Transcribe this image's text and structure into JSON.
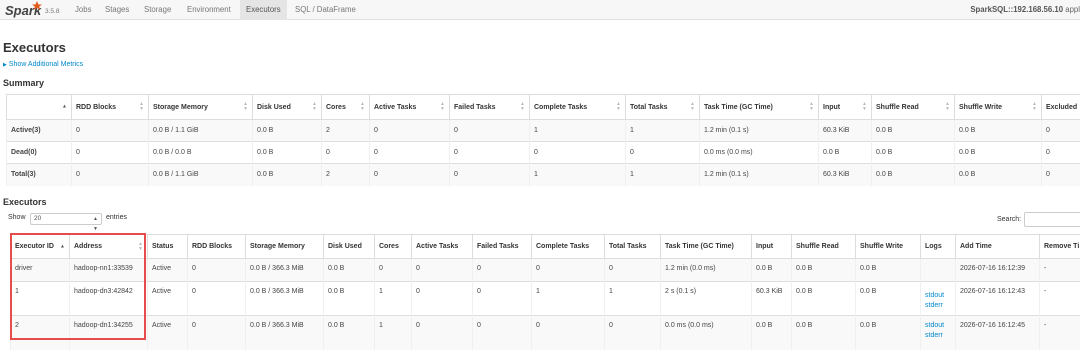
{
  "nav": {
    "logo_text": "Spark",
    "version": "3.5.8",
    "items": [
      "Jobs",
      "Stages",
      "Storage",
      "Environment",
      "Executors",
      "SQL / DataFrame"
    ],
    "active": "Executors",
    "app_title": "SparkSQL::192.168.56.10",
    "app_suffix": " appl"
  },
  "page": {
    "title": "Executors",
    "show_metrics": "Show Additional Metrics",
    "summary_heading": "Summary",
    "executors_heading": "Executors"
  },
  "summary": {
    "headers": [
      "",
      "RDD Blocks",
      "Storage Memory",
      "Disk Used",
      "Cores",
      "Active Tasks",
      "Failed Tasks",
      "Complete Tasks",
      "Total Tasks",
      "Task Time (GC Time)",
      "Input",
      "Shuffle Read",
      "Shuffle Write",
      "Excluded"
    ],
    "rows": [
      [
        "Active(3)",
        "0",
        "0.0 B / 1.1 GiB",
        "0.0 B",
        "2",
        "0",
        "0",
        "1",
        "1",
        "1.2 min (0.1 s)",
        "60.3 KiB",
        "0.0 B",
        "0.0 B",
        "0"
      ],
      [
        "Dead(0)",
        "0",
        "0.0 B / 0.0 B",
        "0.0 B",
        "0",
        "0",
        "0",
        "0",
        "0",
        "0.0 ms (0.0 ms)",
        "0.0 B",
        "0.0 B",
        "0.0 B",
        "0"
      ],
      [
        "Total(3)",
        "0",
        "0.0 B / 1.1 GiB",
        "0.0 B",
        "2",
        "0",
        "0",
        "1",
        "1",
        "1.2 min (0.1 s)",
        "60.3 KiB",
        "0.0 B",
        "0.0 B",
        "0"
      ]
    ]
  },
  "controls": {
    "show_label": "Show",
    "page_size": "20",
    "entries_label": "entries",
    "search_label": "Search:"
  },
  "executors": {
    "headers": [
      "Executor ID",
      "Address",
      "Status",
      "RDD Blocks",
      "Storage Memory",
      "Disk Used",
      "Cores",
      "Active Tasks",
      "Failed Tasks",
      "Complete Tasks",
      "Total Tasks",
      "Task Time (GC Time)",
      "Input",
      "Shuffle Read",
      "Shuffle Write",
      "Logs",
      "Add Time",
      "Remove Ti"
    ],
    "rows": [
      {
        "id": "driver",
        "address": "hadoop-nn1:33539",
        "status": "Active",
        "rdd": "0",
        "storage": "0.0 B / 366.3 MiB",
        "disk": "0.0 B",
        "cores": "0",
        "active": "0",
        "failed": "0",
        "complete": "0",
        "total": "0",
        "task_time": "1.2 min (0.0 ms)",
        "input": "0.0 B",
        "shuffle_read": "0.0 B",
        "shuffle_write": "0.0 B",
        "logs": [],
        "add_time": "2026-07-16 16:12:39",
        "remove_time": "-"
      },
      {
        "id": "1",
        "address": "hadoop-dn3:42842",
        "status": "Active",
        "rdd": "0",
        "storage": "0.0 B / 366.3 MiB",
        "disk": "0.0 B",
        "cores": "1",
        "active": "0",
        "failed": "0",
        "complete": "1",
        "total": "1",
        "task_time": "2 s (0.1 s)",
        "input": "60.3 KiB",
        "shuffle_read": "0.0 B",
        "shuffle_write": "0.0 B",
        "logs": [
          "stdout",
          "stderr"
        ],
        "add_time": "2026-07-16 16:12:43",
        "remove_time": "-"
      },
      {
        "id": "2",
        "address": "hadoop-dn1:34255",
        "status": "Active",
        "rdd": "0",
        "storage": "0.0 B / 366.3 MiB",
        "disk": "0.0 B",
        "cores": "1",
        "active": "0",
        "failed": "0",
        "complete": "0",
        "total": "0",
        "task_time": "0.0 ms (0.0 ms)",
        "input": "0.0 B",
        "shuffle_read": "0.0 B",
        "shuffle_write": "0.0 B",
        "logs": [
          "stdout",
          "stderr"
        ],
        "add_time": "2026-07-16 16:12:45",
        "remove_time": "-"
      }
    ]
  },
  "colors": {
    "accent_link": "#0088cc",
    "highlight_box": "#e74c4c",
    "logo_orange": "#e25a1c"
  }
}
